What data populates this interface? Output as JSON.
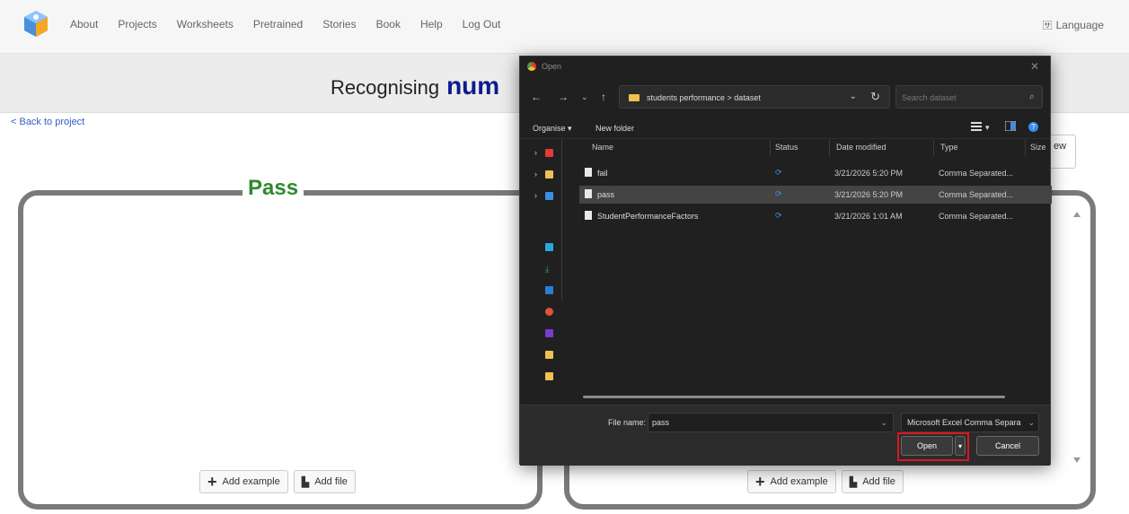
{
  "nav": {
    "links": [
      "About",
      "Projects",
      "Worksheets",
      "Pretrained",
      "Stories",
      "Book",
      "Help",
      "Log Out"
    ],
    "language": "Language"
  },
  "page": {
    "title_prefix": "Recognising",
    "title_keyword": "num",
    "back_link": "< Back to project",
    "partial_button": "ew"
  },
  "buckets": {
    "pass_label": "Pass",
    "add_example": "Add example",
    "add_file": "Add file"
  },
  "dialog": {
    "title": "Open",
    "path": "students performance  >  dataset",
    "search_placeholder": "Search dataset",
    "toolbar": {
      "organise": "Organise ▾",
      "new_folder": "New folder"
    },
    "columns": {
      "name": "Name",
      "status": "Status",
      "date": "Date modified",
      "type": "Type",
      "size": "Size"
    },
    "files": [
      {
        "name": "fail",
        "date": "3/21/2026 5:20 PM",
        "type": "Comma Separated..."
      },
      {
        "name": "pass",
        "date": "3/21/2026 5:20 PM",
        "type": "Comma Separated..."
      },
      {
        "name": "StudentPerformanceFactors",
        "date": "3/21/2026 1:01 AM",
        "type": "Comma Separated..."
      }
    ],
    "file_name_label": "File name:",
    "file_name_value": "pass",
    "file_type": "Microsoft Excel Comma Separa",
    "open_label": "Open",
    "cancel_label": "Cancel"
  }
}
